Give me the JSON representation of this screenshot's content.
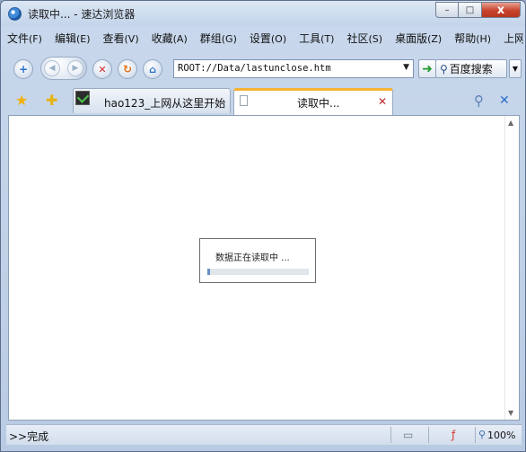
{
  "window": {
    "title": "读取中... - 速达浏览器",
    "controls": {
      "minimize": "–",
      "maximize": "□",
      "close": "x"
    }
  },
  "menu": [
    {
      "label": "文件",
      "accel": "(F)"
    },
    {
      "label": "编辑",
      "accel": "(E)"
    },
    {
      "label": "查看",
      "accel": "(V)"
    },
    {
      "label": "收藏",
      "accel": "(A)"
    },
    {
      "label": "群组",
      "accel": "(G)"
    },
    {
      "label": "设置",
      "accel": "(O)"
    },
    {
      "label": "工具",
      "accel": "(T)"
    },
    {
      "label": "社区",
      "accel": "(S)"
    },
    {
      "label": "桌面版",
      "accel": "(Z)"
    },
    {
      "label": "帮助",
      "accel": "(H)"
    },
    {
      "label": "上网",
      "accel": ""
    }
  ],
  "toolbar": {
    "address_value": "ROOT://Data/lastunclose.htm",
    "search_label": "百度搜索"
  },
  "tabs": [
    {
      "label": "hao123_上网从这里开始",
      "active": false
    },
    {
      "label": "读取中...",
      "active": true
    }
  ],
  "content": {
    "loading_text": "数据正在读取中 ...",
    "progress": 0.03
  },
  "status": {
    "text": ">>完成",
    "zoom": "100%"
  }
}
